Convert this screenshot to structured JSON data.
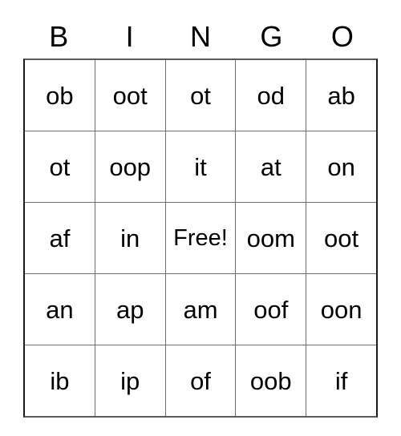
{
  "card": {
    "headers": [
      "B",
      "I",
      "N",
      "G",
      "O"
    ],
    "rows": [
      [
        "ob",
        "oot",
        "ot",
        "od",
        "ab"
      ],
      [
        "ot",
        "oop",
        "it",
        "at",
        "on"
      ],
      [
        "af",
        "in",
        "Free!",
        "oom",
        "oot"
      ],
      [
        "an",
        "ap",
        "am",
        "oof",
        "oon"
      ],
      [
        "ib",
        "ip",
        "of",
        "oob",
        "if"
      ]
    ],
    "free_space": {
      "label": "Free!",
      "row": 2,
      "column": 2
    },
    "colors": {
      "text": "#000000",
      "background": "#ffffff",
      "outer_border": "#1a1a1a",
      "inner_border": "#6e6e6e"
    }
  }
}
